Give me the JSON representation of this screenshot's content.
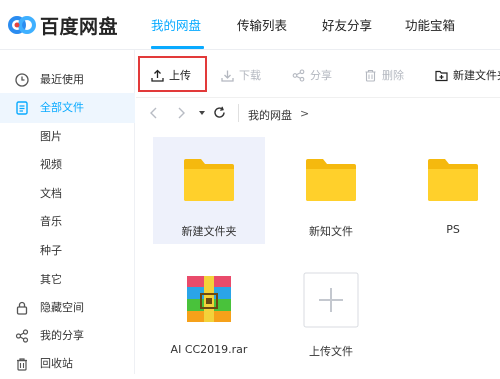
{
  "header": {
    "logo_text": "百度网盘",
    "tabs": [
      {
        "label": "我的网盘"
      },
      {
        "label": "传输列表"
      },
      {
        "label": "好友分享"
      },
      {
        "label": "功能宝箱"
      }
    ],
    "accent_color": "#09aaff"
  },
  "sidebar": {
    "items": [
      {
        "label": "最近使用",
        "icon": "clock-icon"
      },
      {
        "label": "全部文件",
        "icon": "document-icon"
      },
      {
        "label": "图片"
      },
      {
        "label": "视频"
      },
      {
        "label": "文档"
      },
      {
        "label": "音乐"
      },
      {
        "label": "种子"
      },
      {
        "label": "其它"
      },
      {
        "label": "隐藏空间",
        "icon": "lock-icon"
      },
      {
        "label": "我的分享",
        "icon": "share-icon"
      },
      {
        "label": "回收站",
        "icon": "trash-icon"
      }
    ]
  },
  "toolbar": {
    "upload_label": "上传",
    "download_label": "下载",
    "share_label": "分享",
    "delete_label": "删除",
    "new_folder_label": "新建文件夹",
    "highlight_color": "#e23a3a"
  },
  "breadcrumb": {
    "current": "我的网盘",
    "separator": ">"
  },
  "files": [
    {
      "name": "新建文件夹",
      "type": "folder"
    },
    {
      "name": "新知文件",
      "type": "folder"
    },
    {
      "name": "PS",
      "type": "folder"
    },
    {
      "name": "AI CC2019.rar",
      "type": "archive"
    },
    {
      "name": "上传文件",
      "type": "upload-tile"
    }
  ]
}
